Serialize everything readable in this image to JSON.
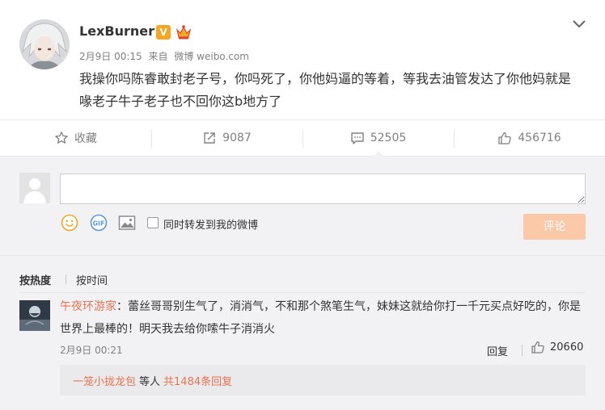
{
  "post": {
    "username": "LexBurner",
    "verified_badge": "V",
    "date": "2月9日 00:15",
    "source_prefix": "来自",
    "source": "微博 weibo.com",
    "text": "我操你吗陈睿敢封老子号，你吗死了，你他妈逼的等着，等我去油管发达了你他妈就是喙老子牛子老子也不回你这b地方了",
    "expand_icon": "chevron-down-icon"
  },
  "actions": [
    {
      "icon": "star-icon",
      "label": "收藏"
    },
    {
      "icon": "share-icon",
      "label": "9087"
    },
    {
      "icon": "comment-icon",
      "label": "52505"
    },
    {
      "icon": "thumbs-up-icon",
      "label": "456716"
    }
  ],
  "composer": {
    "placeholder": "",
    "forward_label": "同时转发到我的微博",
    "submit_label": "评论",
    "icons": [
      "emoji-icon",
      "gif-icon",
      "image-icon"
    ]
  },
  "sort": {
    "hot_label": "按热度",
    "time_label": "按时间"
  },
  "comment": {
    "author": "午夜环游家",
    "separator": "：",
    "text": "蕾丝哥哥别生气了，消消气，不和那个煞笔生气，妹妹这就给你打一千元买点好吃的，你是世界上最棒的！明天我去给你嗦牛子消消火",
    "time": "2月9日 00:21",
    "reply_label": "回复",
    "likes": "20660",
    "sub_replies": {
      "name": "一笼小拢龙包",
      "middle": "等人",
      "count_text": "共1484条回复"
    }
  },
  "colors": {
    "accent": "#eb7350",
    "submit_disabled": "#fbc9a8",
    "panel_bg": "#f2f2f5"
  }
}
